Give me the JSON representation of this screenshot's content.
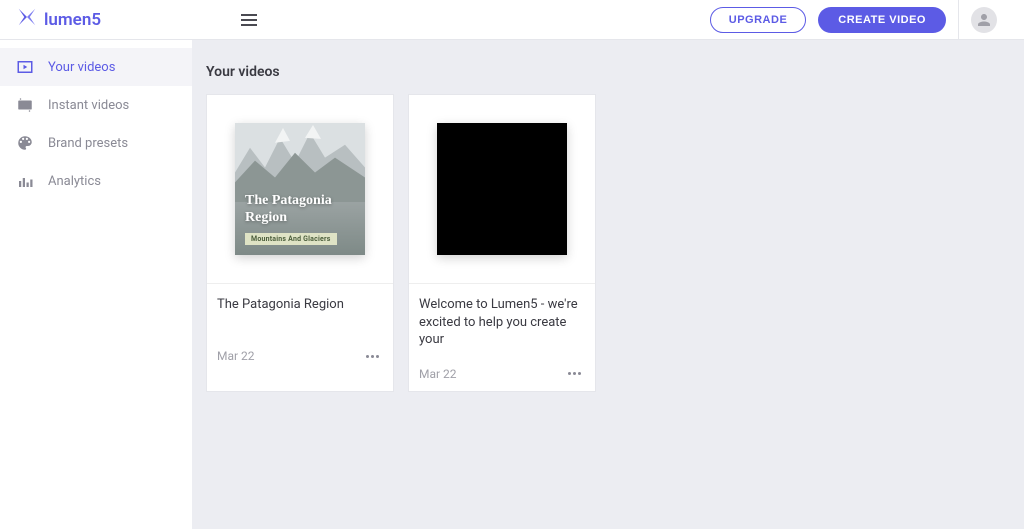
{
  "header": {
    "logo_text": "lumen5",
    "upgrade_label": "UPGRADE",
    "create_label": "CREATE VIDEO"
  },
  "sidebar": {
    "items": [
      {
        "label": "Your videos",
        "icon": "play"
      },
      {
        "label": "Instant videos",
        "icon": "sparkle-video"
      },
      {
        "label": "Brand presets",
        "icon": "palette"
      },
      {
        "label": "Analytics",
        "icon": "bars"
      }
    ]
  },
  "main": {
    "title": "Your videos",
    "cards": [
      {
        "thumb_title": "The Patagonia Region",
        "thumb_badge": "Mountains And Glaciers",
        "title": "The Patagonia Region",
        "date": "Mar 22"
      },
      {
        "title": "Welcome to Lumen5 - we're excited to help you create your",
        "date": "Mar 22"
      }
    ]
  }
}
